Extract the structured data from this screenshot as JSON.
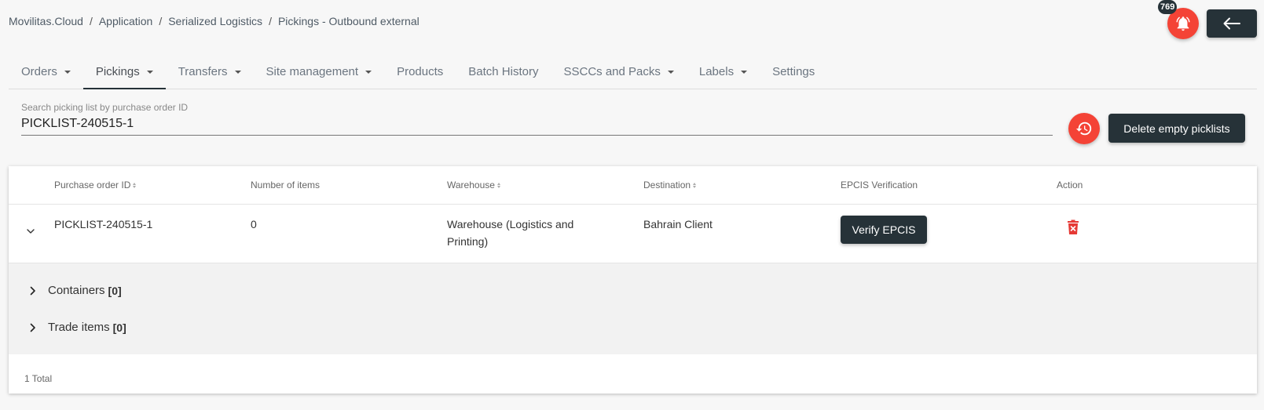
{
  "breadcrumb": [
    "Movilitas.Cloud",
    "Application",
    "Serialized Logistics",
    "Pickings - Outbound external"
  ],
  "breadcrumb_separator": "/",
  "notifications": {
    "count": "769",
    "accent": "#f44336"
  },
  "nav": {
    "items": [
      {
        "label": "Orders",
        "dropdown": true
      },
      {
        "label": "Pickings",
        "dropdown": true,
        "active": true
      },
      {
        "label": "Transfers",
        "dropdown": true
      },
      {
        "label": "Site management",
        "dropdown": true
      },
      {
        "label": "Products",
        "dropdown": false
      },
      {
        "label": "Batch History",
        "dropdown": false
      },
      {
        "label": "SSCCs and Packs",
        "dropdown": true
      },
      {
        "label": "Labels",
        "dropdown": true
      },
      {
        "label": "Settings",
        "dropdown": false
      }
    ]
  },
  "search": {
    "label": "Search picking list by purchase order ID",
    "value": "PICKLIST-240515-1"
  },
  "actions": {
    "delete_empty_label": "Delete empty picklists"
  },
  "table": {
    "columns": [
      "Purchase order ID",
      "Number of items",
      "Warehouse",
      "Destination",
      "EPCIS Verification",
      "Action"
    ],
    "rows": [
      {
        "purchase_order_id": "PICKLIST-240515-1",
        "number_of_items": "0",
        "warehouse": "Warehouse (Logistics and Printing)",
        "destination": "Bahrain Client",
        "verify_label": "Verify EPCIS"
      }
    ],
    "details": [
      {
        "label": "Containers",
        "count": "[0]"
      },
      {
        "label": "Trade items",
        "count": "[0]"
      }
    ],
    "total": "1 Total"
  },
  "colors": {
    "dark": "#263238",
    "danger": "#f44336",
    "background": "#f7f7f7"
  }
}
